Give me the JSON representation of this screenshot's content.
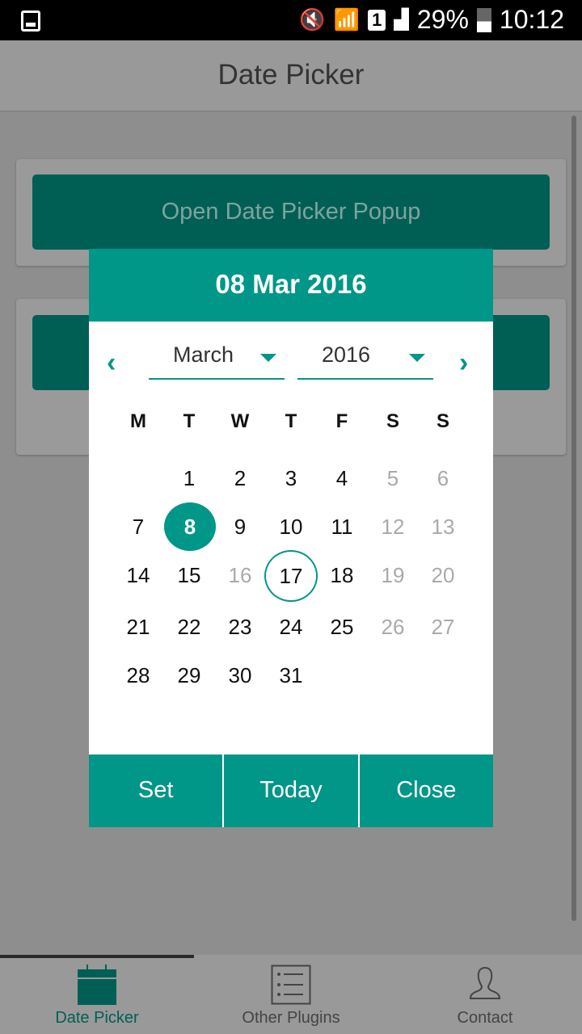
{
  "status_bar": {
    "battery": "29%",
    "time": "10:12",
    "sim": "1",
    "icons": [
      "image-icon",
      "vibrate-mute-icon",
      "wifi-icon",
      "sim-icon",
      "signal-icon",
      "battery-icon"
    ]
  },
  "header": {
    "title": "Date Picker"
  },
  "main": {
    "open_popup_label": "Open Date Picker Popup"
  },
  "datepicker": {
    "selected_display": "08 Mar 2016",
    "month": "March",
    "year": "2016",
    "weekdays": [
      "M",
      "T",
      "W",
      "T",
      "F",
      "S",
      "S"
    ],
    "selected_day": "8",
    "today_day": "17",
    "disabled_days": [
      "5",
      "6",
      "12",
      "13",
      "16",
      "19",
      "20",
      "26",
      "27"
    ],
    "weeks": [
      [
        "",
        "1",
        "2",
        "3",
        "4",
        "5",
        "6"
      ],
      [
        "7",
        "8",
        "9",
        "10",
        "11",
        "12",
        "13"
      ],
      [
        "14",
        "15",
        "16",
        "17",
        "18",
        "19",
        "20"
      ],
      [
        "21",
        "22",
        "23",
        "24",
        "25",
        "26",
        "27"
      ],
      [
        "28",
        "29",
        "30",
        "31",
        "",
        "",
        ""
      ]
    ],
    "buttons": {
      "set": "Set",
      "today": "Today",
      "close": "Close"
    }
  },
  "tabs": [
    {
      "label": "Date Picker",
      "icon": "calendar-icon",
      "active": true
    },
    {
      "label": "Other Plugins",
      "icon": "list-icon"
    },
    {
      "label": "Contact",
      "icon": "person-icon"
    }
  ],
  "colors": {
    "accent": "#009688",
    "dark_accent": "#005f55"
  }
}
